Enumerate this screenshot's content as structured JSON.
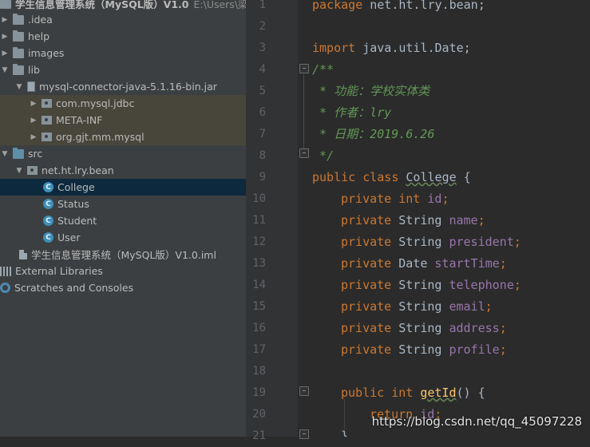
{
  "project_tree": {
    "root": {
      "name": "学生信息管理系统（MySQL版）V1.0",
      "path": "E:\\Users\\梁\\学"
    },
    "items": [
      {
        "label": ".idea"
      },
      {
        "label": "help"
      },
      {
        "label": "images"
      },
      {
        "label": "lib"
      },
      {
        "label": "mysql-connector-java-5.1.16-bin.jar"
      },
      {
        "label": "com.mysql.jdbc"
      },
      {
        "label": "META-INF"
      },
      {
        "label": "org.gjt.mm.mysql"
      },
      {
        "label": "src"
      },
      {
        "label": "net.ht.lry.bean"
      },
      {
        "label": "College",
        "icon_letter": "C"
      },
      {
        "label": "Status",
        "icon_letter": "C"
      },
      {
        "label": "Student",
        "icon_letter": "C"
      },
      {
        "label": "User",
        "icon_letter": "C"
      },
      {
        "label": "学生信息管理系统（MySQL版）V1.0.iml"
      },
      {
        "label": "External Libraries"
      },
      {
        "label": "Scratches and Consoles"
      }
    ]
  },
  "editor": {
    "line_numbers": [
      "1",
      "2",
      "3",
      "4",
      "5",
      "6",
      "7",
      "8",
      "9",
      "10",
      "11",
      "12",
      "13",
      "14",
      "15",
      "16",
      "17",
      "18",
      "19",
      "20",
      "21"
    ],
    "code": {
      "l1_kw": "package",
      "l1_rest": " net.ht.lry.bean;",
      "l3_kw": "import",
      "l3_rest": " java.util.Date;",
      "l4": "/**",
      "l5": " * 功能：学校实体类",
      "l6": " * 作者：lry",
      "l7": " * 日期：2019.6.26",
      "l8": " */",
      "l9_kw": "public class",
      "l9_name": "College",
      "l9_rest": " {",
      "l10_kw": "private int",
      "l10_field": "id",
      "l11_kw": "private",
      "l11_type": " String ",
      "l11_field": "name",
      "l12_kw": "private",
      "l12_type": " String ",
      "l12_field": "president",
      "l13_kw": "private",
      "l13_type": " Date ",
      "l13_field": "startTime",
      "l14_kw": "private",
      "l14_type": " String ",
      "l14_field": "telephone",
      "l15_kw": "private",
      "l15_type": " String ",
      "l15_field": "email",
      "l16_kw": "private",
      "l16_type": " String ",
      "l16_field": "address",
      "l17_kw": "private",
      "l17_type": " String ",
      "l17_field": "profile",
      "l19_kw": "public int",
      "l19_method": "getId",
      "l19_rest": "() {",
      "l20_kw": "return",
      "l20_field": "id",
      "l21": "}",
      "semicolon": ";"
    }
  },
  "watermark": "https://blog.csdn.net/qq_45097228",
  "colors": {
    "keyword": "#cc7832",
    "comment": "#629755",
    "field": "#9876aa",
    "method": "#ffc66d",
    "selection": "#0d293e"
  }
}
